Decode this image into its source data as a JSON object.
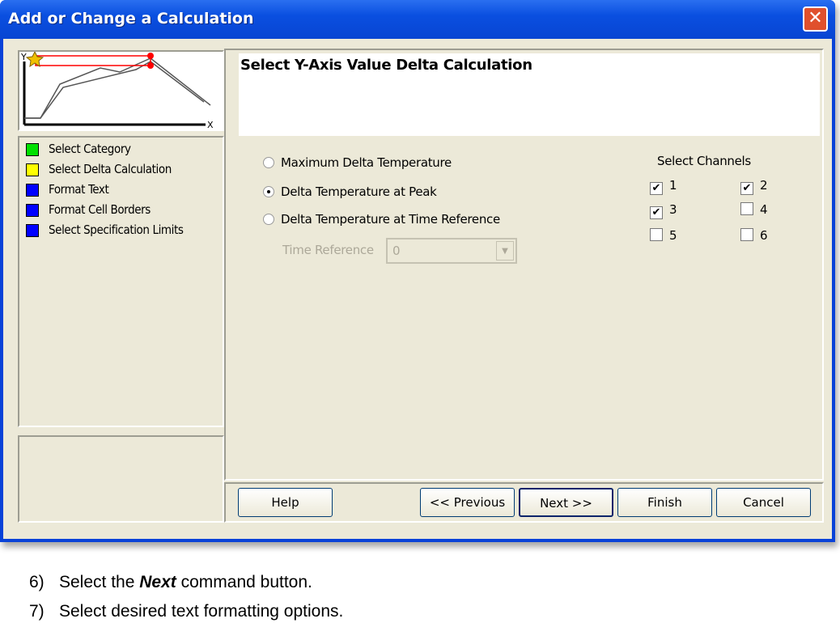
{
  "window": {
    "title": "Add or Change a Calculation",
    "close_icon": "close-icon"
  },
  "thumbnail": {
    "y_label": "Y",
    "x_label": "X"
  },
  "steps": [
    {
      "label": "Select Category",
      "color": "#00e000"
    },
    {
      "label": "Select Delta Calculation",
      "color": "#ffff00"
    },
    {
      "label": "Format Text",
      "color": "#0000ff"
    },
    {
      "label": "Format Cell Borders",
      "color": "#0000ff"
    },
    {
      "label": "Select Specification Limits",
      "color": "#0000ff"
    }
  ],
  "main": {
    "heading": "Select Y-Axis Value Delta Calculation",
    "options": [
      {
        "label": "Maximum Delta Temperature",
        "selected": false
      },
      {
        "label": "Delta Temperature at Peak",
        "selected": true
      },
      {
        "label": "Delta Temperature at Time Reference",
        "selected": false
      }
    ],
    "time_reference": {
      "label": "Time Reference",
      "value": "0",
      "enabled": false
    },
    "channels": {
      "label": "Select Channels",
      "items": [
        {
          "label": "1",
          "checked": true
        },
        {
          "label": "2",
          "checked": true
        },
        {
          "label": "3",
          "checked": true
        },
        {
          "label": "4",
          "checked": false
        },
        {
          "label": "5",
          "checked": false
        },
        {
          "label": "6",
          "checked": false
        }
      ]
    }
  },
  "buttons": {
    "help": "Help",
    "previous": "<< Previous",
    "next": "Next >>",
    "finish": "Finish",
    "cancel": "Cancel"
  },
  "instructions": [
    {
      "num": "6)",
      "before": "Select the ",
      "bold": "Next",
      "after": " command button."
    },
    {
      "num": "7)",
      "text": "Select desired text formatting options."
    }
  ]
}
